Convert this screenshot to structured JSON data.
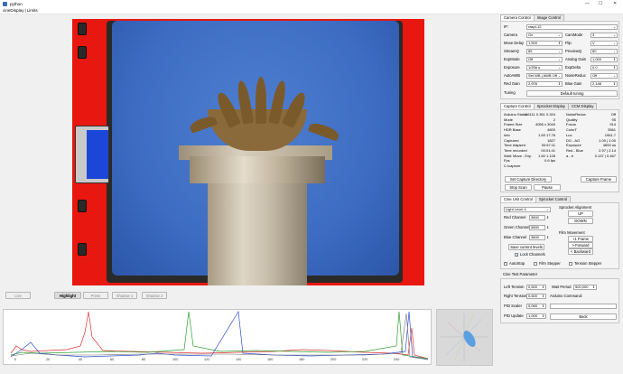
{
  "window": {
    "title": "python",
    "minimize": "—",
    "maximize": "☐",
    "close": "✕"
  },
  "menu": {
    "items": [
      "cineDisplay",
      "|",
      "Limits"
    ]
  },
  "viewer_buttons": [
    "Live",
    "Highlight",
    "Prime",
    "Shadow 1",
    "Shadow 2"
  ],
  "histogram": {
    "ticks": [
      "0",
      "20",
      "40",
      "60",
      "80",
      "100",
      "120",
      "140",
      "160",
      "180",
      "200",
      "220",
      "240"
    ],
    "colors": {
      "red": "#e03030",
      "green": "#30a030",
      "blue": "#3050d0",
      "grey": "#707070"
    }
  },
  "camera_tabs": [
    "Camera Control",
    "Image Control"
  ],
  "camera": {
    "ip_label": "IP:",
    "ip_value": "raspi-12",
    "left": [
      {
        "label": "Camera",
        "value": "On"
      },
      {
        "label": "Move Delay",
        "value": "1,500"
      },
      {
        "label": "StreamQ",
        "value": "85"
      },
      {
        "label": "ExpMode",
        "value": "Off"
      },
      {
        "label": "Exposure",
        "value": "1/256 s"
      },
      {
        "label": "AutoAWB",
        "value": "Set WB | AWB Off"
      },
      {
        "label": "Red Gain",
        "value": "2,976"
      }
    ],
    "right": [
      {
        "label": "CamMode",
        "value": "3"
      },
      {
        "label": "Flip",
        "value": "V"
      },
      {
        "label": "PreviewQ",
        "value": "80"
      },
      {
        "label": "Analog Gain",
        "value": "1,000"
      },
      {
        "label": "ExpDelta",
        "value": "0.0"
      },
      {
        "label": "NoiseReduc",
        "value": "Off"
      },
      {
        "label": "Blue Gain",
        "value": "2,146"
      }
    ],
    "tuning_label": "Tuning",
    "tuning_value": "Default tuning"
  },
  "capture_tabs": [
    "Capture Control",
    "Sprocket Display",
    "CCM Display"
  ],
  "capture": {
    "left": [
      {
        "k": "Arduino Status",
        "v": "111111 0.361 0.324"
      },
      {
        "k": "Mode",
        "v": "2"
      },
      {
        "k": "Frame Size",
        "v": "4056 x 3040"
      },
      {
        "k": "HDR Base",
        "v": "4600"
      },
      {
        "k": "Info",
        "v": "1.59 17.76"
      },
      {
        "k": "Captured",
        "v": "1827"
      },
      {
        "k": "Time elapsed",
        "v": "00:57:11"
      },
      {
        "k": "Time recorded",
        "v": "00:01:41"
      },
      {
        "k": "Wait: Move - Exp",
        "v": "1.50 1.128"
      },
      {
        "k": "Fps",
        "v": "0.6 fps"
      },
      {
        "k": "C:\\capture",
        "v": ""
      }
    ],
    "right": [
      {
        "k": "NoiseRedux",
        "v": "Off"
      },
      {
        "k": "Quality",
        "v": "95"
      },
      {
        "k": "Focus",
        "v": "914"
      },
      {
        "k": "ColorT",
        "v": "3561"
      },
      {
        "k": "Lux",
        "v": "1961.7"
      },
      {
        "k": "DG - AG",
        "v": "1.00 | 1.00"
      },
      {
        "k": "Exposure",
        "v": "4600 us"
      },
      {
        "k": "Red - Blue",
        "v": "2.97 | 2.14"
      },
      {
        "k": "a - b",
        "v": "0.137 | 0.467"
      }
    ],
    "set_dir": "Set Capture Directory",
    "capture_frame": "Capture Frame",
    "stop_scan": "Stop Scan",
    "pause": "Pause"
  },
  "cine_tabs": [
    "Cine Unit Control",
    "Sprocket Control"
  ],
  "cine": {
    "light_level": "Light Level 4",
    "sprocket_alignment": "Sprocket Alignment",
    "up": "UP",
    "down": "DOWN",
    "channels": [
      {
        "label": "Red Channel",
        "value": "3800"
      },
      {
        "label": "Green Channel",
        "value": "3800"
      },
      {
        "label": "Blue Channel",
        "value": "3800"
      }
    ],
    "film_movement": "Film Movement",
    "plus_frame": "+1 Frame",
    "forward": "> Forward",
    "backward": "< Backward",
    "save_levels": "Save current levels",
    "lock_channels": "Lock Channels",
    "autostop": "AutoStop",
    "film_stepper": "Film Stepper",
    "tension_stepper": "Tension Stepper"
  },
  "test": {
    "title": "Cine Test Parameter",
    "left_tension": "Left Tension",
    "left_tension_v": "0,500",
    "wait_period": "Wait Period",
    "wait_period_v": "500,000",
    "right_tension": "Right Tension",
    "right_tension_v": "0,600",
    "arduino_cmd": "Arduino Command:",
    "pid_scaler": "PID Scaler",
    "pid_scaler_v": "0,060",
    "pid_update": "PID Update",
    "pid_update_v": "1,000",
    "back": "Back"
  }
}
